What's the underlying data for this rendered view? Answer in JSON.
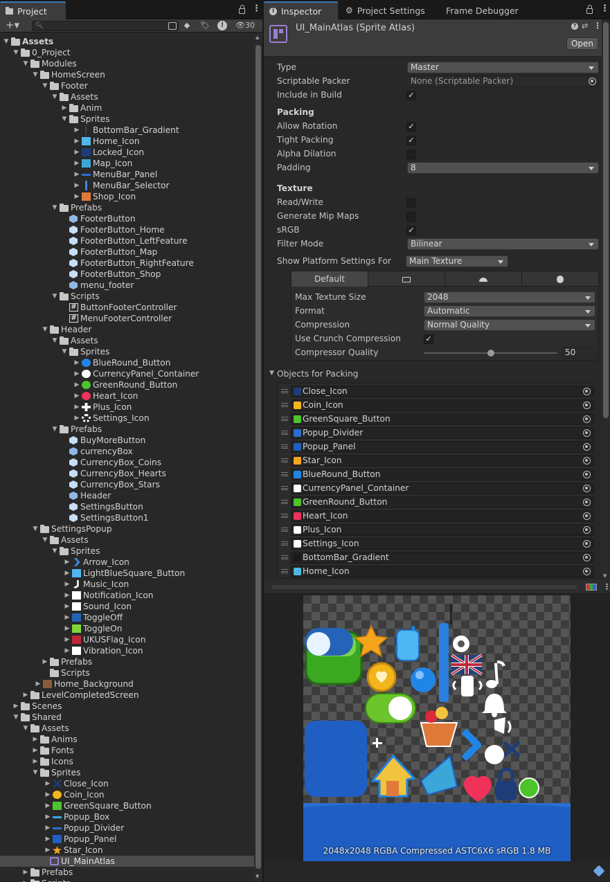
{
  "project_panel": {
    "tab_label": "Project",
    "hidden_count": "30",
    "search_placeholder": "",
    "tree": [
      {
        "label": "Assets",
        "depth": 0,
        "type": "folder",
        "expanded": true,
        "bold": true
      },
      {
        "label": "0_Project",
        "depth": 1,
        "type": "folder",
        "expanded": true
      },
      {
        "label": "Modules",
        "depth": 2,
        "type": "folder",
        "expanded": true
      },
      {
        "label": "HomeScreen",
        "depth": 3,
        "type": "folder",
        "expanded": true
      },
      {
        "label": "Footer",
        "depth": 4,
        "type": "folder",
        "expanded": true
      },
      {
        "label": "Assets",
        "depth": 5,
        "type": "folder",
        "expanded": true
      },
      {
        "label": "Anim",
        "depth": 6,
        "type": "folder",
        "expanded": false
      },
      {
        "label": "Sprites",
        "depth": 6,
        "type": "folder",
        "expanded": true
      },
      {
        "label": "BottomBar_Gradient",
        "depth": 7,
        "type": "sprite",
        "color": "#333333"
      },
      {
        "label": "Home_Icon",
        "depth": 7,
        "type": "sprite",
        "color": "#4fb7e8"
      },
      {
        "label": "Locked_Icon",
        "depth": 7,
        "type": "sprite",
        "color": "#1e3d78"
      },
      {
        "label": "Map_Icon",
        "depth": 7,
        "type": "sprite",
        "color": "#3aa7d8"
      },
      {
        "label": "MenuBar_Panel",
        "depth": 7,
        "type": "sprite",
        "color": "#2a6ed2"
      },
      {
        "label": "MenuBar_Selector",
        "depth": 7,
        "type": "sprite",
        "color": "#3d86e0"
      },
      {
        "label": "Shop_Icon",
        "depth": 7,
        "type": "sprite",
        "color": "#e07a3a"
      },
      {
        "label": "Prefabs",
        "depth": 5,
        "type": "folder",
        "expanded": true
      },
      {
        "label": "FooterButton",
        "depth": 6,
        "type": "prefab"
      },
      {
        "label": "FooterButton_Home",
        "depth": 6,
        "type": "prefab2"
      },
      {
        "label": "FooterButton_LeftFeature",
        "depth": 6,
        "type": "prefab2"
      },
      {
        "label": "FooterButton_Map",
        "depth": 6,
        "type": "prefab2"
      },
      {
        "label": "FooterButton_RightFeature",
        "depth": 6,
        "type": "prefab2"
      },
      {
        "label": "FooterButton_Shop",
        "depth": 6,
        "type": "prefab2"
      },
      {
        "label": "menu_footer",
        "depth": 6,
        "type": "prefab"
      },
      {
        "label": "Scripts",
        "depth": 5,
        "type": "folder",
        "expanded": true
      },
      {
        "label": "ButtonFooterController",
        "depth": 6,
        "type": "script"
      },
      {
        "label": "MenuFooterController",
        "depth": 6,
        "type": "script"
      },
      {
        "label": "Header",
        "depth": 4,
        "type": "folder",
        "expanded": true
      },
      {
        "label": "Assets",
        "depth": 5,
        "type": "folder",
        "expanded": true
      },
      {
        "label": "Sprites",
        "depth": 6,
        "type": "folder",
        "expanded": true
      },
      {
        "label": "BlueRound_Button",
        "depth": 7,
        "type": "sprite",
        "color": "#1f86e8",
        "round": true
      },
      {
        "label": "CurrencyPanel_Container",
        "depth": 7,
        "type": "sprite",
        "color": "#ffffff",
        "round": true
      },
      {
        "label": "GreenRound_Button",
        "depth": 7,
        "type": "sprite",
        "color": "#4cc42c",
        "round": true
      },
      {
        "label": "Heart_Icon",
        "depth": 7,
        "type": "sprite",
        "color": "#f0325a",
        "round": true
      },
      {
        "label": "Plus_Icon",
        "depth": 7,
        "type": "sprite",
        "color": "#ffffff",
        "plus": true
      },
      {
        "label": "Settings_Icon",
        "depth": 7,
        "type": "sprite",
        "color": "#ffffff",
        "gear": true
      },
      {
        "label": "Prefabs",
        "depth": 5,
        "type": "folder",
        "expanded": true
      },
      {
        "label": "BuyMoreButton",
        "depth": 6,
        "type": "prefab2"
      },
      {
        "label": "currencyBox",
        "depth": 6,
        "type": "prefab"
      },
      {
        "label": "CurrencyBox_Coins",
        "depth": 6,
        "type": "prefab2"
      },
      {
        "label": "CurrencyBox_Hearts",
        "depth": 6,
        "type": "prefab2"
      },
      {
        "label": "CurrencyBox_Stars",
        "depth": 6,
        "type": "prefab2"
      },
      {
        "label": "Header",
        "depth": 6,
        "type": "prefab"
      },
      {
        "label": "SettingsButton",
        "depth": 6,
        "type": "prefab2"
      },
      {
        "label": "SettingsButton1",
        "depth": 6,
        "type": "prefab2"
      },
      {
        "label": "SettingsPopup",
        "depth": 3,
        "type": "folder",
        "expanded": true
      },
      {
        "label": "Assets",
        "depth": 4,
        "type": "folder",
        "expanded": true
      },
      {
        "label": "Sprites",
        "depth": 5,
        "type": "folder",
        "expanded": true
      },
      {
        "label": "Arrow_Icon",
        "depth": 6,
        "type": "sprite",
        "color": "#3d86e0",
        "chev": true
      },
      {
        "label": "LightBlueSquare_Button",
        "depth": 6,
        "type": "sprite",
        "color": "#4eb6f2"
      },
      {
        "label": "Music_Icon",
        "depth": 6,
        "type": "sprite",
        "color": "#ffffff",
        "note": true
      },
      {
        "label": "Notification_Icon",
        "depth": 6,
        "type": "sprite",
        "color": "#ffffff"
      },
      {
        "label": "Sound_Icon",
        "depth": 6,
        "type": "sprite",
        "color": "#ffffff"
      },
      {
        "label": "ToggleOff",
        "depth": 6,
        "type": "sprite",
        "color": "#2563b8"
      },
      {
        "label": "ToggleOn",
        "depth": 6,
        "type": "sprite",
        "color": "#7ed63a"
      },
      {
        "label": "UKUSFlag_Icon",
        "depth": 6,
        "type": "sprite",
        "color": "#c0283a"
      },
      {
        "label": "Vibration_Icon",
        "depth": 6,
        "type": "sprite",
        "color": "#ffffff"
      },
      {
        "label": "Prefabs",
        "depth": 4,
        "type": "folder",
        "expanded": false
      },
      {
        "label": "Scripts",
        "depth": 4,
        "type": "folder",
        "noarrow": true
      },
      {
        "label": "Home_Background",
        "depth": 3,
        "type": "sprite",
        "color": "#8a5a3c"
      },
      {
        "label": "LevelCompletedScreen",
        "depth": 2,
        "type": "folder",
        "expanded": false
      },
      {
        "label": "Scenes",
        "depth": 1,
        "type": "folder",
        "expanded": false
      },
      {
        "label": "Shared",
        "depth": 1,
        "type": "folder",
        "expanded": true
      },
      {
        "label": "Assets",
        "depth": 2,
        "type": "folder",
        "expanded": true
      },
      {
        "label": "Anims",
        "depth": 3,
        "type": "folder",
        "expanded": false
      },
      {
        "label": "Fonts",
        "depth": 3,
        "type": "folder",
        "expanded": false
      },
      {
        "label": "Icons",
        "depth": 3,
        "type": "folder",
        "expanded": false
      },
      {
        "label": "Sprites",
        "depth": 3,
        "type": "folder",
        "expanded": true
      },
      {
        "label": "Close_Icon",
        "depth": 4,
        "type": "sprite",
        "color": "#1e3d78",
        "cross": true
      },
      {
        "label": "Coin_Icon",
        "depth": 4,
        "type": "sprite",
        "color": "#f2b51c",
        "round": true
      },
      {
        "label": "GreenSquare_Button",
        "depth": 4,
        "type": "sprite",
        "color": "#4cc42c"
      },
      {
        "label": "Popup_Box",
        "depth": 4,
        "type": "sprite",
        "color": "#35a8ea",
        "bar": true
      },
      {
        "label": "Popup_Divider",
        "depth": 4,
        "type": "sprite",
        "color": "#2a6ed2",
        "bar": true
      },
      {
        "label": "Popup_Panel",
        "depth": 4,
        "type": "sprite",
        "color": "#1f5fc4"
      },
      {
        "label": "Star_Icon",
        "depth": 4,
        "type": "sprite",
        "color": "#f5a51c",
        "star": true
      },
      {
        "label": "UI_MainAtlas",
        "depth": 4,
        "type": "atlas",
        "selected": true
      },
      {
        "label": "Prefabs",
        "depth": 2,
        "type": "folder",
        "expanded": false
      },
      {
        "label": "Scripts",
        "depth": 2,
        "type": "folder",
        "expanded": false
      }
    ]
  },
  "inspector": {
    "tabs": [
      "Inspector",
      "Project Settings",
      "Frame Debugger"
    ],
    "asset_title": "UI_MainAtlas (Sprite Atlas)",
    "open_button": "Open",
    "type_label": "Type",
    "type_value": "Master",
    "scriptable_packer_label": "Scriptable Packer",
    "scriptable_packer_value": "None (Scriptable Packer)",
    "include_in_build_label": "Include in Build",
    "include_in_build": true,
    "packing_header": "Packing",
    "allow_rotation_label": "Allow Rotation",
    "allow_rotation": true,
    "tight_packing_label": "Tight Packing",
    "tight_packing": true,
    "alpha_dilation_label": "Alpha Dilation",
    "alpha_dilation": false,
    "padding_label": "Padding",
    "padding_value": "8",
    "texture_header": "Texture",
    "read_write_label": "Read/Write",
    "read_write": false,
    "mip_maps_label": "Generate Mip Maps",
    "mip_maps": false,
    "srgb_label": "sRGB",
    "srgb": true,
    "filter_mode_label": "Filter Mode",
    "filter_mode_value": "Bilinear",
    "platform_settings_label": "Show Platform Settings For",
    "platform_settings_value": "Main Texture",
    "platform_tabs": [
      "Default",
      "monitor-icon",
      "android-icon",
      "apple-icon"
    ],
    "max_texture_size_label": "Max Texture Size",
    "max_texture_size_value": "2048",
    "format_label": "Format",
    "format_value": "Automatic",
    "compression_label": "Compression",
    "compression_value": "Normal Quality",
    "crunch_label": "Use Crunch Compression",
    "crunch": true,
    "compressor_quality_label": "Compressor Quality",
    "compressor_quality_value": "50",
    "compressor_quality_fraction": 0.5,
    "objects_header": "Objects for Packing",
    "objects": [
      {
        "label": "Close_Icon",
        "color": "#1e3d78"
      },
      {
        "label": "Coin_Icon",
        "color": "#f2b51c"
      },
      {
        "label": "GreenSquare_Button",
        "color": "#4cc42c"
      },
      {
        "label": "Popup_Divider",
        "color": "#2a6ed2"
      },
      {
        "label": "Popup_Panel",
        "color": "#1f5fc4"
      },
      {
        "label": "Star_Icon",
        "color": "#f5a51c"
      },
      {
        "label": "BlueRound_Button",
        "color": "#1f86e8"
      },
      {
        "label": "CurrencyPanel_Container",
        "color": "#ffffff"
      },
      {
        "label": "GreenRound_Button",
        "color": "#4cc42c"
      },
      {
        "label": "Heart_Icon",
        "color": "#f0325a"
      },
      {
        "label": "Plus_Icon",
        "color": "#ffffff"
      },
      {
        "label": "Settings_Icon",
        "color": "#ffffff"
      },
      {
        "label": "BottomBar_Gradient",
        "color": "#1a1a1a"
      },
      {
        "label": "Home_Icon",
        "color": "#4fb7e8"
      }
    ],
    "preview_info": "2048x2048 RGBA Compressed ASTC6X6 sRGB   1.8 MB"
  }
}
